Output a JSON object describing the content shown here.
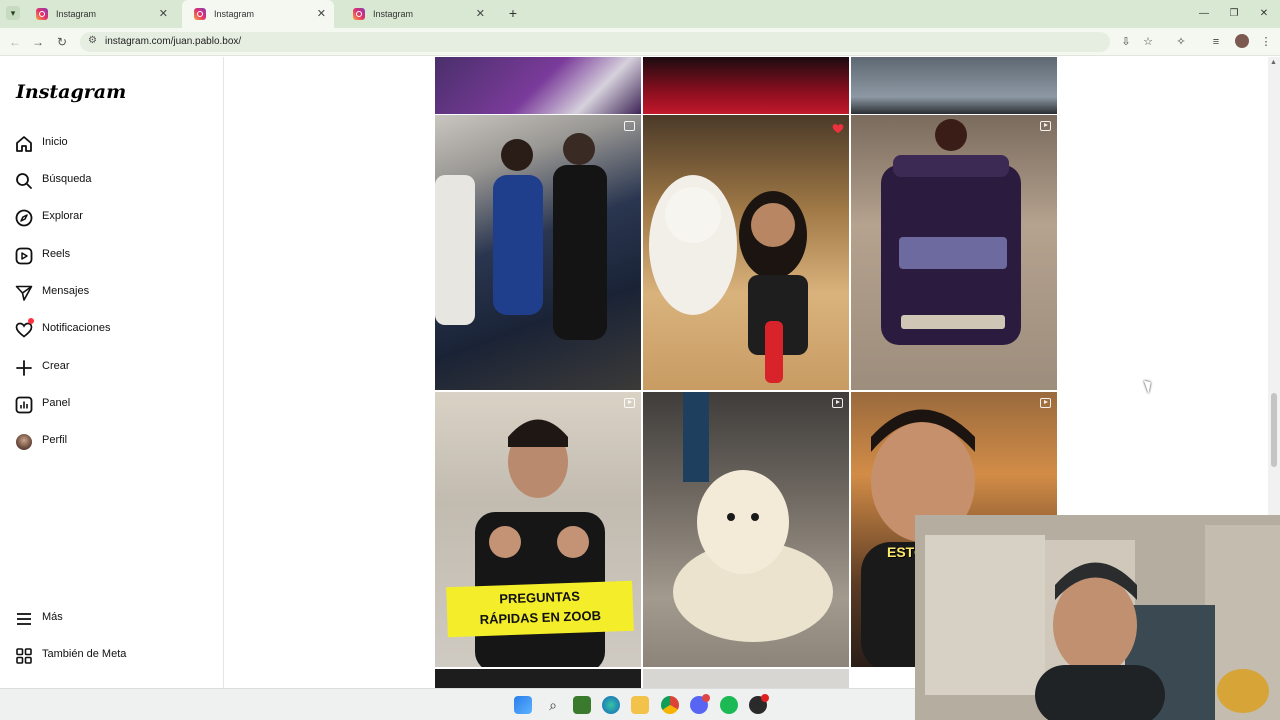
{
  "browser": {
    "tabs": [
      {
        "title": "Instagram",
        "active": false
      },
      {
        "title": "Instagram",
        "active": true
      },
      {
        "title": "Instagram",
        "active": false
      }
    ],
    "url": "instagram.com/juan.pablo.box/"
  },
  "sidebar": {
    "logo": "Instagram",
    "items": [
      {
        "label": "Inicio",
        "icon": "home-icon"
      },
      {
        "label": "Búsqueda",
        "icon": "search-icon"
      },
      {
        "label": "Explorar",
        "icon": "compass-icon"
      },
      {
        "label": "Reels",
        "icon": "reels-icon"
      },
      {
        "label": "Mensajes",
        "icon": "send-icon"
      },
      {
        "label": "Notificaciones",
        "icon": "heart-icon"
      },
      {
        "label": "Crear",
        "icon": "plus-icon"
      },
      {
        "label": "Panel",
        "icon": "chart-icon"
      },
      {
        "label": "Perfil",
        "icon": "avatar"
      }
    ],
    "bottom_items": [
      {
        "label": "Más",
        "icon": "menu-icon"
      },
      {
        "label": "También de Meta",
        "icon": "meta-icon"
      }
    ]
  },
  "grid": {
    "posts": [
      {
        "kind": "image",
        "subject": "boxing-ring"
      },
      {
        "kind": "image",
        "subject": "red-screen"
      },
      {
        "kind": "image",
        "subject": "event-floor"
      },
      {
        "kind": "carousel",
        "subject": "boxers"
      },
      {
        "kind": "image",
        "subject": "woman-with-dog",
        "liked": true
      },
      {
        "kind": "reel",
        "subject": "whey-protein"
      },
      {
        "kind": "reel",
        "subject": "thumbs-up",
        "caption": [
          "PREGUNTAS",
          "RÁPIDAS EN ZOOB"
        ]
      },
      {
        "kind": "reel",
        "subject": "samoyed-dog"
      },
      {
        "kind": "reel",
        "subject": "selfie-video",
        "overlay_text": "ESTO"
      }
    ]
  },
  "colors": {
    "notification_dot": "#ff3040",
    "caption_bg": "#f4ee2a"
  }
}
